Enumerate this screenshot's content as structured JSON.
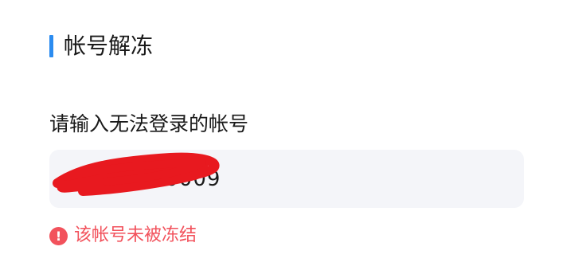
{
  "page": {
    "title": "帐号解冻"
  },
  "form": {
    "account_label": "请输入无法登录的帐号",
    "account_value": "1603300009"
  },
  "error": {
    "icon": "exclamation-icon",
    "icon_glyph": "!",
    "message": "该帐号未被冻结"
  },
  "colors": {
    "accent": "#2b8cf0",
    "error": "#f2525c",
    "redaction": "#e8191f",
    "input_bg": "#f4f5f9"
  }
}
